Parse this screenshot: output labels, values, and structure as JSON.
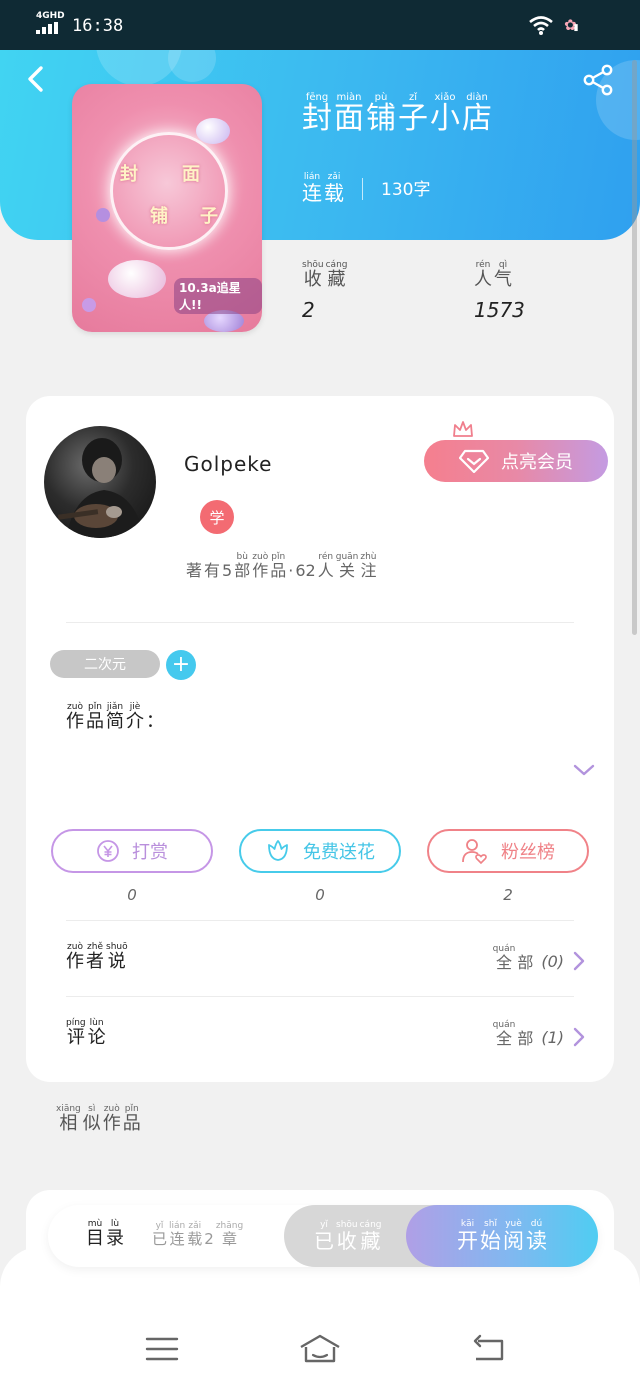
{
  "status_bar": {
    "network": "4GHD",
    "time": "16:38"
  },
  "header": {
    "title": [
      {
        "py": "fēng",
        "hz": "封"
      },
      {
        "py": "miàn",
        "hz": "面"
      },
      {
        "py": "pù",
        "hz": "铺"
      },
      {
        "py": "zǐ",
        "hz": "子"
      },
      {
        "py": "xiǎo",
        "hz": "小"
      },
      {
        "py": "diàn",
        "hz": "店"
      }
    ],
    "status": [
      {
        "py": "lián",
        "hz": "连"
      },
      {
        "py": "zǎi",
        "hz": "载"
      }
    ],
    "word_count": "130字",
    "stats": {
      "collect_label": [
        {
          "py": "shōu",
          "hz": "收"
        },
        {
          "py": "cáng",
          "hz": "藏"
        }
      ],
      "collect_value": "2",
      "popularity_label": [
        {
          "py": "rén",
          "hz": "人"
        },
        {
          "py": "qì",
          "hz": "气"
        }
      ],
      "popularity_value": "1573"
    },
    "cover": {
      "glyphs": [
        "封",
        "面",
        "铺",
        "子"
      ],
      "badge": "10.3a追星人!!"
    }
  },
  "author": {
    "name": "Golpeke",
    "level": "学",
    "vip_label": "点亮会员",
    "summary": [
      {
        "py": "",
        "hz": "著"
      },
      {
        "py": "",
        "hz": "有"
      },
      {
        "py": "",
        "hz": "5"
      },
      {
        "py": "bù",
        "hz": "部"
      },
      {
        "py": "zuò",
        "hz": "作"
      },
      {
        "py": "pǐn",
        "hz": "品"
      },
      {
        "py": "",
        "hz": "·"
      },
      {
        "py": "",
        "hz": "62"
      },
      {
        "py": "rén",
        "hz": "人"
      },
      {
        "py": "guān",
        "hz": "关"
      },
      {
        "py": "zhù",
        "hz": "注"
      }
    ]
  },
  "tags": {
    "chip": "二次元"
  },
  "intro": {
    "label": [
      {
        "py": "zuò",
        "hz": "作"
      },
      {
        "py": "pǐn",
        "hz": "品"
      },
      {
        "py": "jiǎn",
        "hz": "简"
      },
      {
        "py": "jiè",
        "hz": "介"
      },
      {
        "py": "",
        "hz": "："
      }
    ]
  },
  "actions": {
    "reward": {
      "label": "打赏",
      "count": "0"
    },
    "flower": {
      "label": "免费送花",
      "count": "0"
    },
    "fans": {
      "label": "粉丝榜",
      "count": "2"
    }
  },
  "author_talk": {
    "label": [
      {
        "py": "zuò",
        "hz": "作"
      },
      {
        "py": "zhě",
        "hz": "者"
      },
      {
        "py": "shuō",
        "hz": "说"
      }
    ],
    "all": [
      {
        "py": "quán",
        "hz": "全"
      },
      {
        "py": "",
        "hz": "部"
      }
    ],
    "count": "(0)"
  },
  "comments": {
    "label": [
      {
        "py": "píng",
        "hz": "评"
      },
      {
        "py": "lùn",
        "hz": "论"
      }
    ],
    "all": [
      {
        "py": "quán",
        "hz": "全"
      },
      {
        "py": "",
        "hz": "部"
      }
    ],
    "count": "(1)"
  },
  "similar": {
    "label": [
      {
        "py": "xiāng",
        "hz": "相"
      },
      {
        "py": "sì",
        "hz": "似"
      },
      {
        "py": "zuò",
        "hz": "作"
      },
      {
        "py": "pǐn",
        "hz": "品"
      }
    ]
  },
  "bottom_bar": {
    "toc": [
      {
        "py": "mù",
        "hz": "目"
      },
      {
        "py": "lù",
        "hz": "录"
      }
    ],
    "toc_sub": [
      {
        "py": "yǐ",
        "hz": "已"
      },
      {
        "py": "lián",
        "hz": "连"
      },
      {
        "py": "zǎi",
        "hz": "载"
      },
      {
        "py": "",
        "hz": "2"
      },
      {
        "py": "zhāng",
        "hz": "章"
      }
    ],
    "collected": [
      {
        "py": "yǐ",
        "hz": "已"
      },
      {
        "py": "shōu",
        "hz": "收"
      },
      {
        "py": "cáng",
        "hz": "藏"
      }
    ],
    "start_reading": [
      {
        "py": "kāi",
        "hz": "开"
      },
      {
        "py": "shǐ",
        "hz": "始"
      },
      {
        "py": "yuè",
        "hz": "阅"
      },
      {
        "py": "dú",
        "hz": "读"
      }
    ]
  },
  "colors": {
    "header_start": "#41d4f2",
    "header_end": "#2fa0ef",
    "vip_start": "#f57f8e",
    "vip_end": "#c49be2",
    "reward": "#c596e6",
    "flower": "#47cbea",
    "fans": "#f08288",
    "read_start": "#b09fe6",
    "read_end": "#4fcdf2"
  },
  "icons": [
    "back-icon",
    "share-icon",
    "crown-icon",
    "diamond-icon",
    "plus-icon",
    "chevron-down-icon",
    "yen-icon",
    "flower-icon",
    "person-heart-icon",
    "chevron-right-icon",
    "menu-icon",
    "home-icon",
    "return-icon"
  ]
}
